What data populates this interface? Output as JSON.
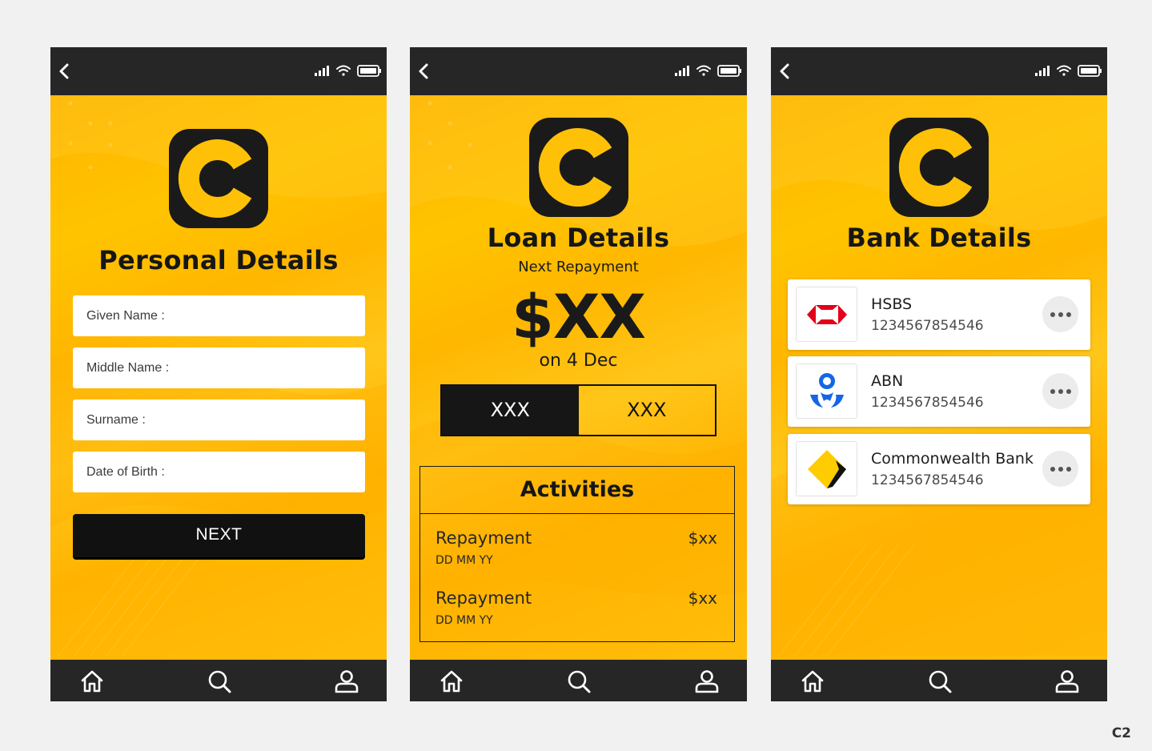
{
  "screens": {
    "personal": {
      "title": "Personal Details",
      "fields": [
        {
          "label": "Given Name :"
        },
        {
          "label": "Middle Name :"
        },
        {
          "label": "Surname :"
        },
        {
          "label": "Date of Birth :"
        }
      ],
      "next_label": "NEXT"
    },
    "loan": {
      "title": "Loan Details",
      "next_repayment_label": "Next Repayment",
      "amount": "$XX",
      "due_label": "on 4 Dec",
      "toggle": [
        "XXX",
        "XXX"
      ],
      "activities_title": "Activities",
      "activities": [
        {
          "label": "Repayment",
          "date": "DD MM YY",
          "amount": "$xx"
        },
        {
          "label": "Repayment",
          "date": "DD MM YY",
          "amount": "$xx"
        }
      ]
    },
    "bank": {
      "title": "Bank Details",
      "banks": [
        {
          "name": "HSBS",
          "account": "1234567854546",
          "logo": "hsbc-logo"
        },
        {
          "name": "ABN",
          "account": "1234567854546",
          "logo": "anz-logo"
        },
        {
          "name": "Commonwealth Bank",
          "account": "1234567854546",
          "logo": "commbank-logo"
        }
      ]
    }
  },
  "icons": {
    "back": "chevron-left-icon",
    "signal": "signal-icon",
    "wifi": "wifi-icon",
    "battery": "battery-icon",
    "home": "home-icon",
    "search": "search-icon",
    "user": "user-icon",
    "more": "more-horizontal-icon"
  },
  "colors": {
    "accent": "#ffc107",
    "dark": "#262626",
    "black": "#111111"
  },
  "corner_label": "C2"
}
